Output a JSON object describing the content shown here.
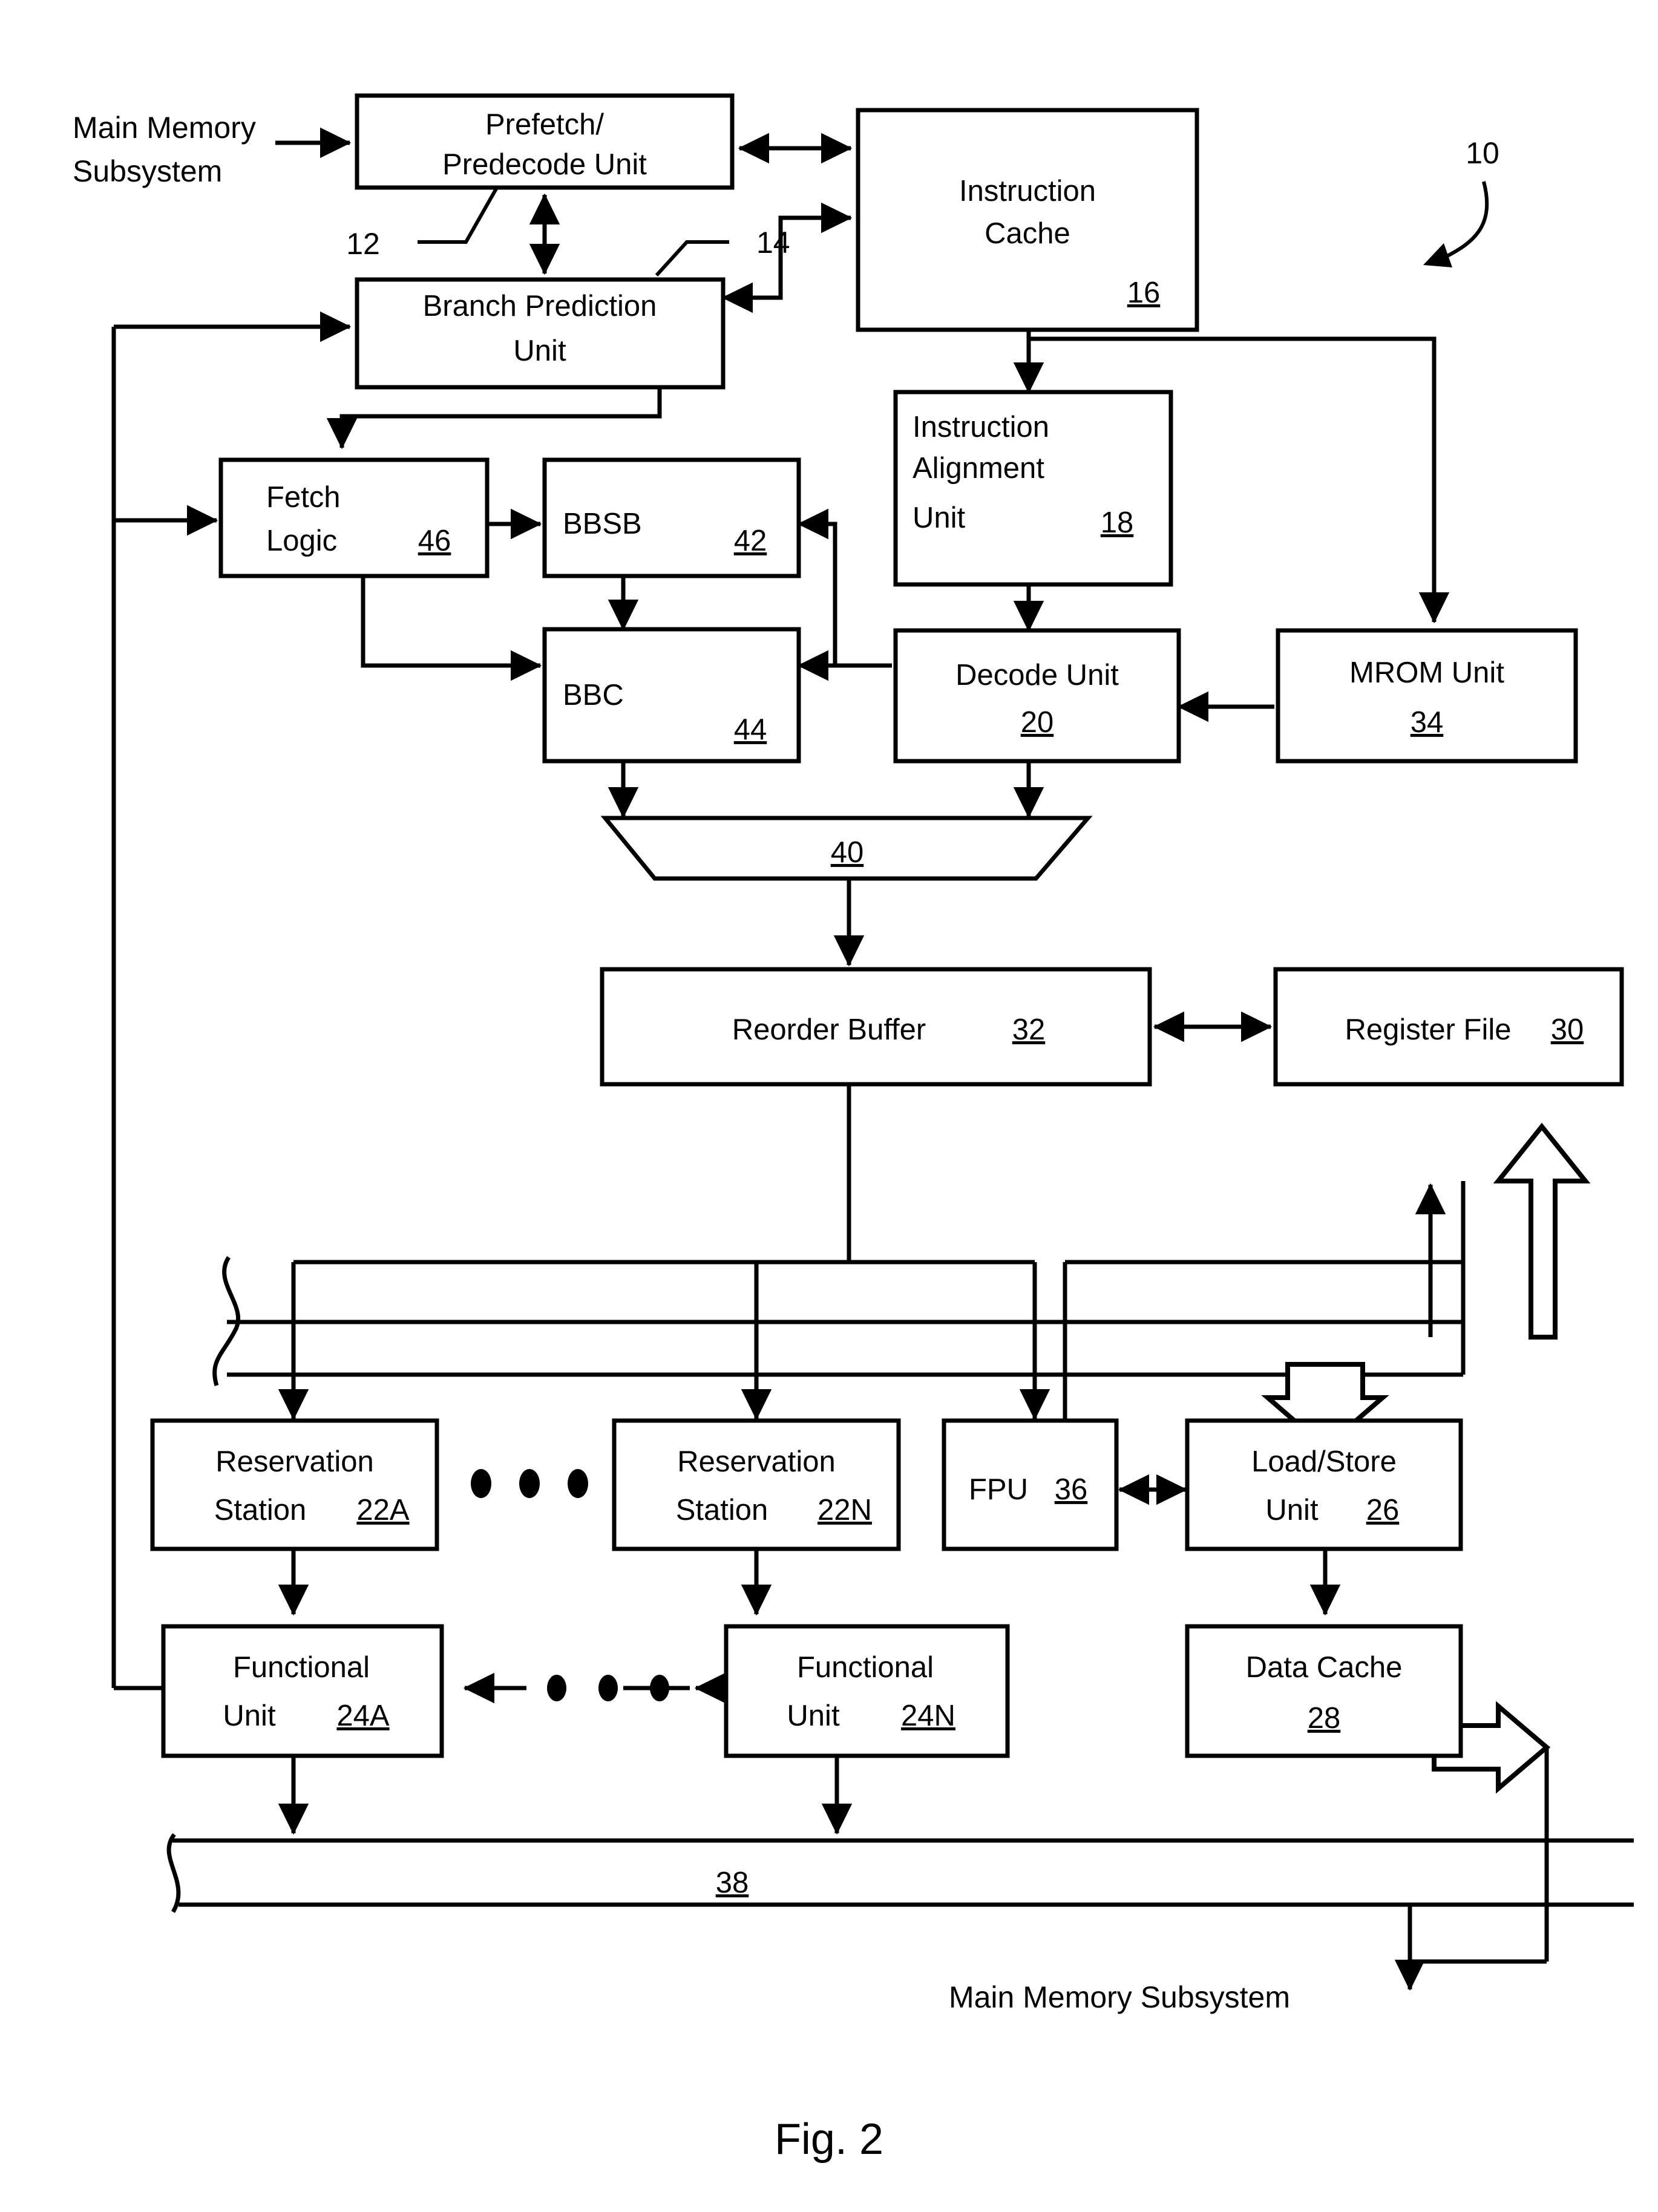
{
  "figure": {
    "caption": "Fig. 2",
    "system_ref": "10"
  },
  "external_labels": {
    "top_left": "Main Memory\nSubsystem",
    "top_left_line1": "Main Memory",
    "top_left_line2": "Subsystem",
    "bottom_right": "Main Memory Subsystem"
  },
  "lead_refs": [
    {
      "name": "prefetch-predecode-lead",
      "text": "12"
    },
    {
      "name": "branch-prediction-lead",
      "text": "14"
    },
    {
      "name": "system-lead",
      "text": "10"
    }
  ],
  "blocks": [
    {
      "id": "prefetch",
      "lines": [
        "Prefetch/",
        "Predecode Unit"
      ],
      "ref": ""
    },
    {
      "id": "instruction_cache",
      "lines": [
        "Instruction",
        "Cache"
      ],
      "ref": "16"
    },
    {
      "id": "branch_prediction",
      "lines": [
        "Branch Prediction",
        "Unit"
      ],
      "ref": ""
    },
    {
      "id": "fetch_logic",
      "lines": [
        "Fetch",
        "Logic"
      ],
      "ref": "46"
    },
    {
      "id": "bbsb",
      "lines": [
        "BBSB"
      ],
      "ref": "42"
    },
    {
      "id": "bbc",
      "lines": [
        "BBC"
      ],
      "ref": "44"
    },
    {
      "id": "instruction_alignment",
      "lines": [
        "Instruction",
        "Alignment",
        "Unit"
      ],
      "ref": "18"
    },
    {
      "id": "decode_unit",
      "lines": [
        "Decode Unit"
      ],
      "ref": "20"
    },
    {
      "id": "mrom_unit",
      "lines": [
        "MROM Unit"
      ],
      "ref": "34"
    },
    {
      "id": "mux",
      "lines": [],
      "ref": "40"
    },
    {
      "id": "reorder_buffer",
      "lines": [
        "Reorder Buffer"
      ],
      "ref": "32"
    },
    {
      "id": "register_file",
      "lines": [
        "Register File"
      ],
      "ref": "30"
    },
    {
      "id": "reservation_station_a",
      "lines": [
        "Reservation",
        "Station"
      ],
      "ref": "22A"
    },
    {
      "id": "reservation_station_n",
      "lines": [
        "Reservation",
        "Station"
      ],
      "ref": "22N"
    },
    {
      "id": "fpu",
      "lines": [
        "FPU"
      ],
      "ref": "36"
    },
    {
      "id": "load_store_unit",
      "lines": [
        "Load/Store",
        "Unit"
      ],
      "ref": "26"
    },
    {
      "id": "functional_unit_a",
      "lines": [
        "Functional",
        "Unit"
      ],
      "ref": "24A"
    },
    {
      "id": "functional_unit_n",
      "lines": [
        "Functional",
        "Unit"
      ],
      "ref": "24N"
    },
    {
      "id": "data_cache",
      "lines": [
        "Data Cache"
      ],
      "ref": "28"
    },
    {
      "id": "result_bus",
      "lines": [],
      "ref": "38"
    }
  ],
  "text": {
    "prefetch_l1": "Prefetch/",
    "prefetch_l2": "Predecode Unit",
    "instruction_cache_l1": "Instruction",
    "instruction_cache_l2": "Cache",
    "instruction_cache_ref": "16",
    "branch_prediction_l1": "Branch Prediction",
    "branch_prediction_l2": "Unit",
    "fetch_logic_l1": "Fetch",
    "fetch_logic_l2": "Logic",
    "fetch_logic_ref": "46",
    "bbsb_label": "BBSB",
    "bbsb_ref": "42",
    "bbc_label": "BBC",
    "bbc_ref": "44",
    "ialign_l1": "Instruction",
    "ialign_l2": "Alignment",
    "ialign_l3": "Unit",
    "ialign_ref": "18",
    "decode_label": "Decode Unit",
    "decode_ref": "20",
    "mrom_label": "MROM Unit",
    "mrom_ref": "34",
    "mux_ref": "40",
    "reorder_label": "Reorder Buffer",
    "reorder_ref": "32",
    "regfile_label": "Register File",
    "regfile_ref": "30",
    "rs_a_l1": "Reservation",
    "rs_a_l2": "Station",
    "rs_a_ref": "22A",
    "rs_n_l1": "Reservation",
    "rs_n_l2": "Station",
    "rs_n_ref": "22N",
    "fpu_label": "FPU",
    "fpu_ref": "36",
    "lsu_l1": "Load/Store",
    "lsu_l2": "Unit",
    "lsu_ref": "26",
    "fu_a_l1": "Functional",
    "fu_a_l2": "Unit",
    "fu_a_ref": "24A",
    "fu_n_l1": "Functional",
    "fu_n_l2": "Unit",
    "fu_n_ref": "24N",
    "dcache_label": "Data Cache",
    "dcache_ref": "28",
    "bus_ref": "38",
    "ext_mm_l1": "Main Memory",
    "ext_mm_l2": "Subsystem",
    "ext_mm_bottom": "Main Memory Subsystem",
    "ref_12": "12",
    "ref_14": "14",
    "ref_10": "10",
    "figure_caption": "Fig. 2"
  }
}
